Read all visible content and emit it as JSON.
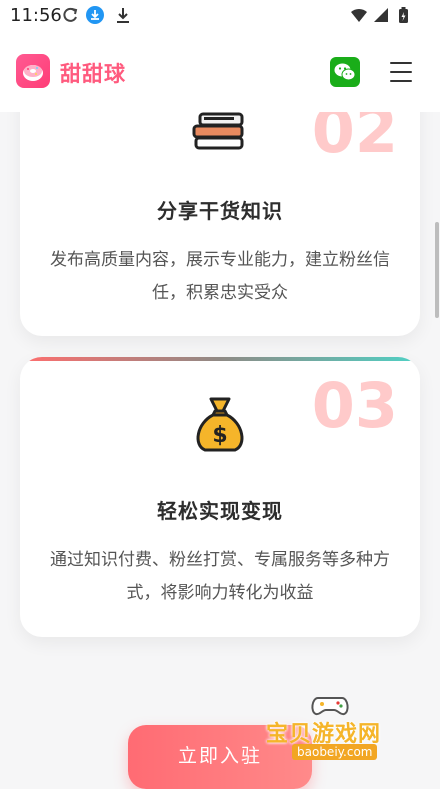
{
  "status_bar": {
    "time": "11:56",
    "icons": [
      "sync-icon",
      "download-badge-icon",
      "download-icon",
      "wifi-icon",
      "signal-icon",
      "battery-icon"
    ]
  },
  "header": {
    "app_name": "甜甜球",
    "logo_icon": "donut-logo-icon",
    "wechat_icon": "wechat-icon",
    "menu_icon": "hamburger-menu-icon"
  },
  "cards": [
    {
      "number": "02",
      "icon": "books-stack-icon",
      "title": "分享干货知识",
      "description": "发布高质量内容，展示专业能力，建立粉丝信任，积累忠实受众"
    },
    {
      "number": "03",
      "icon": "money-bag-icon",
      "title": "轻松实现变现",
      "description": "通过知识付费、粉丝打赏、专属服务等多种方式，将影响力转化为收益"
    }
  ],
  "cta": {
    "label": "立即入驻"
  },
  "watermark": {
    "text": "宝贝游戏网",
    "url": "baobeiy.com"
  },
  "colors": {
    "brand": "#ff5a7e",
    "number_tint": "#ffcaca",
    "cta": "#ff6b73",
    "wechat": "#1aad19"
  }
}
